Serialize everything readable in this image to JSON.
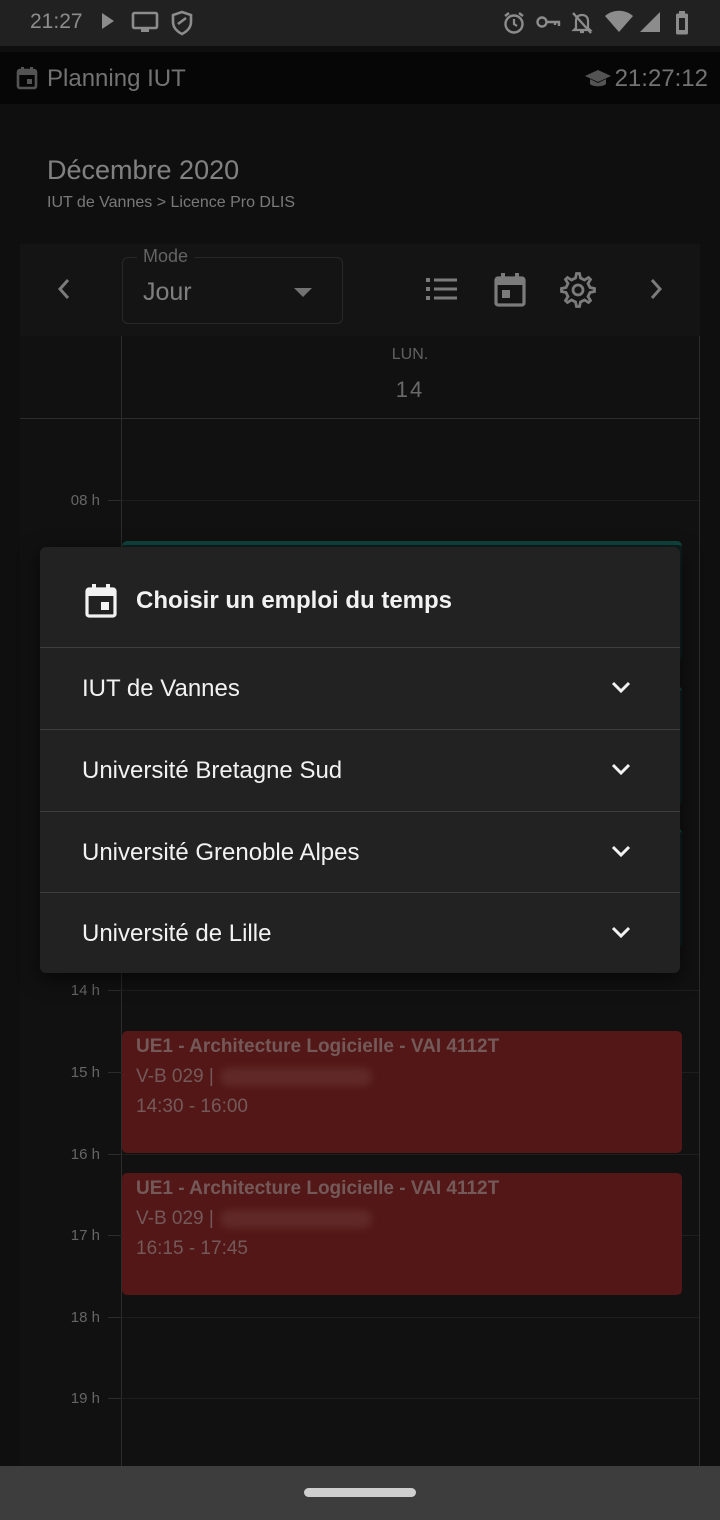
{
  "status_bar": {
    "time": "21:27",
    "left_icons": [
      "play-icon",
      "screen-cast-icon",
      "shield-icon"
    ],
    "right_icons": [
      "alarm-icon",
      "vpn-key-icon",
      "notifications-off-icon",
      "wifi-icon",
      "signal-icon",
      "battery-icon"
    ]
  },
  "app_bar": {
    "title": "Planning IUT",
    "clock": "21:27:12",
    "icons": [
      "calendar-icon",
      "graduation-cap-icon"
    ]
  },
  "header": {
    "month": "Décembre 2020",
    "breadcrumb": "IUT de Vannes > Licence Pro DLIS"
  },
  "toolbar": {
    "mode_label": "Mode",
    "mode_value": "Jour",
    "icons": [
      "chevron-left-icon",
      "list-icon",
      "calendar-icon",
      "gear-icon",
      "chevron-right-icon"
    ]
  },
  "calendar": {
    "day_name": "LUN.",
    "day_number": "14",
    "hours": [
      "08 h",
      "14 h",
      "15 h",
      "16 h",
      "17 h",
      "18 h",
      "19 h"
    ],
    "events": [
      {
        "title": "UE1 - Architecture Logicielle - VAI 4112T",
        "room": "V-B 029 |",
        "time": "14:30 - 16:00",
        "color": "#962a28"
      },
      {
        "title": "UE1 - Architecture Logicielle - VAI 4112T",
        "room": "V-B 029 |",
        "time": "16:15 - 17:45",
        "color": "#962a28"
      }
    ]
  },
  "dialog": {
    "title": "Choisir un emploi du temps",
    "options": [
      {
        "label": "IUT de Vannes"
      },
      {
        "label": "Université Bretagne Sud"
      },
      {
        "label": "Université Grenoble Alpes"
      },
      {
        "label": "Université de Lille"
      }
    ]
  },
  "colors": {
    "event": "#962a28",
    "teal_event_border": "#1f7d70",
    "dialog_bg": "#222222",
    "background": "#1d1d1d"
  }
}
